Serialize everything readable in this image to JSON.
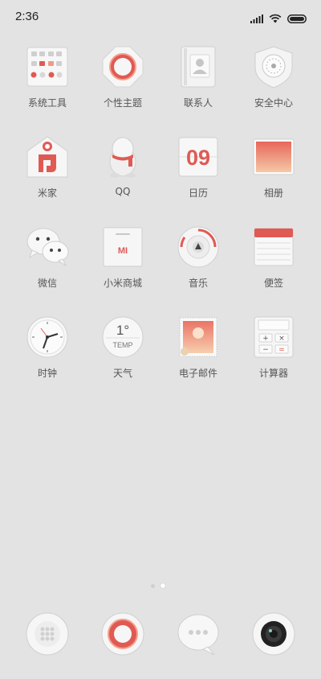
{
  "status": {
    "time": "2:36",
    "signal_icon": "signal-icon",
    "wifi_icon": "wifi-icon",
    "battery_icon": "battery-icon"
  },
  "apps": [
    {
      "label": "系统工具",
      "icon": "system-tools-folder-icon"
    },
    {
      "label": "个性主题",
      "icon": "themes-icon"
    },
    {
      "label": "联系人",
      "icon": "contacts-icon"
    },
    {
      "label": "安全中心",
      "icon": "security-icon"
    },
    {
      "label": "米家",
      "icon": "mi-home-icon"
    },
    {
      "label": "QQ",
      "icon": "qq-icon"
    },
    {
      "label": "日历",
      "icon": "calendar-icon",
      "date": "09"
    },
    {
      "label": "相册",
      "icon": "gallery-icon"
    },
    {
      "label": "微信",
      "icon": "wechat-icon"
    },
    {
      "label": "小米商城",
      "icon": "mi-store-icon",
      "logo": "MI"
    },
    {
      "label": "音乐",
      "icon": "music-icon"
    },
    {
      "label": "便签",
      "icon": "notes-icon"
    },
    {
      "label": "时钟",
      "icon": "clock-icon"
    },
    {
      "label": "天气",
      "icon": "weather-icon",
      "temp": "1°",
      "temp_unit": "TEMP"
    },
    {
      "label": "电子邮件",
      "icon": "email-icon"
    },
    {
      "label": "计算器",
      "icon": "calculator-icon",
      "keys": [
        "+",
        "×",
        "−",
        "="
      ]
    }
  ],
  "pages": {
    "count": 2,
    "active": 2
  },
  "dock": [
    {
      "icon": "phone-icon"
    },
    {
      "icon": "browser-icon"
    },
    {
      "icon": "messages-icon"
    },
    {
      "icon": "camera-icon"
    }
  ],
  "colors": {
    "accent": "#e05a54",
    "background": "#e3e3e3",
    "label": "#555555"
  }
}
